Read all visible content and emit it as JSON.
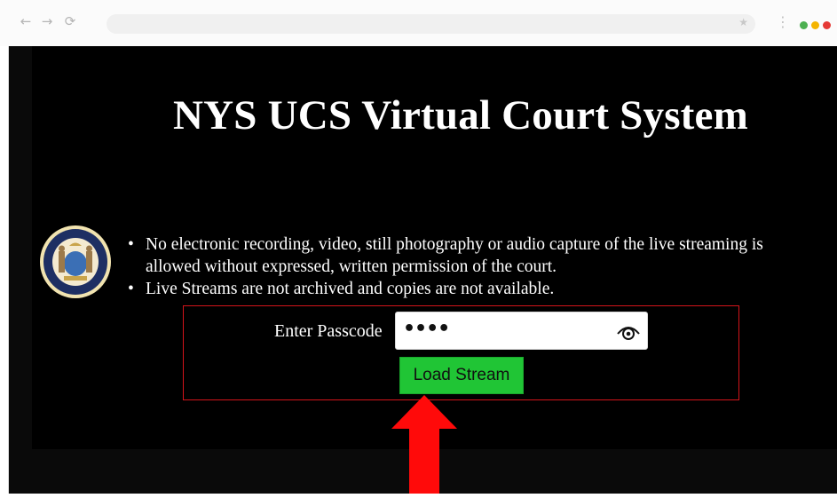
{
  "browser": {
    "back_icon": "arrow-left-icon",
    "forward_icon": "arrow-right-icon",
    "reload_icon": "reload-icon",
    "bookmark_icon": "star-icon",
    "menu_icon": "kebab-menu-icon",
    "dots": [
      "#4caf50",
      "#f4b400",
      "#e53935"
    ]
  },
  "page": {
    "title": "NYS UCS Virtual Court System",
    "seal_icon": "new-york-courts-seal-icon",
    "notices": [
      "No electronic recording, video, still photography or audio capture of the live streaming is allowed without expressed, written permission of the court.",
      "Live Streams are not archived and copies are not available."
    ],
    "passcode_label": "Enter Passcode",
    "passcode_value": "••••",
    "show_password_icon": "eye-icon",
    "load_button": "Load Stream",
    "highlight_color": "#d4141a",
    "button_color": "#20c535",
    "annotation_arrow_icon": "red-arrow-up-icon"
  }
}
